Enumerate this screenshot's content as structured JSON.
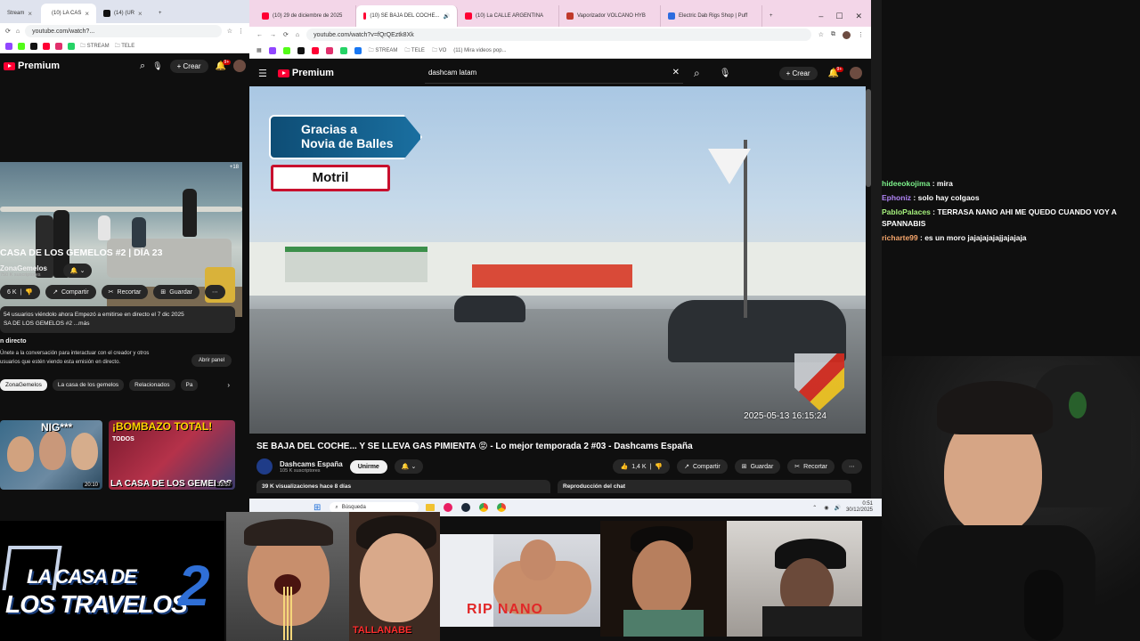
{
  "left_browser": {
    "tabs": [
      {
        "label": "Stream",
        "fav": "#9146ff"
      },
      {
        "label": "(10) LA CAS",
        "fav": "#ff0033"
      },
      {
        "label": "(14) (UR",
        "fav": "#111111"
      }
    ],
    "url": "youtube.com/watch?...",
    "bookmarks": [
      "STREAM",
      "TELE"
    ],
    "premium_label": "Premium",
    "crear_label": "Crear",
    "notif_count": "9+",
    "video_badge": "+18",
    "video_title": "CASA DE LOS GEMELOS #2 | DÍA 23",
    "channel_name": "ZonaGemelos",
    "subscribers": "750 K suscriptores",
    "actions": {
      "likes": "6 K",
      "share": "Compartir",
      "clip": "Recortar",
      "save": "Guardar"
    },
    "description_line1": "54 usuarios viéndolo ahora  Empezó a emitirse en directo el 7 dic 2025",
    "description_line2": "SA DE LOS GEMELOS #2 ...más",
    "live_chat_heading": "n directo",
    "live_chat_text1": "Únete a la conversación para interactuar con el creador y otros",
    "live_chat_text2": "usuarios que estén viendo esta emisión en directo.",
    "open_panel_label": "Abrir panel",
    "chips": [
      "ZonaGemelos",
      "La casa de los gemelos",
      "Relacionados",
      "Pa"
    ],
    "thumbs": [
      {
        "overlay": "NIG***",
        "duration": "20:10"
      },
      {
        "overlay": "¡BOMBAZO TOTAL!",
        "sub1": "TODOS",
        "sub2": "LA CASA DE LOS GEMELOS",
        "duration": "33:57"
      }
    ]
  },
  "right_browser": {
    "tabs": [
      {
        "label": "(10) 29 de diciembre de 2025",
        "fav": "#ff0033",
        "active": false
      },
      {
        "label": "(10) SE BAJA DEL COCHE...",
        "fav": "#ff0033",
        "active": true
      },
      {
        "label": "(10) La CALLE ARGENTINA",
        "fav": "#ff0033",
        "active": false
      },
      {
        "label": "Vaporizador VOLCANO HYB",
        "fav": "#c0392b",
        "active": false
      },
      {
        "label": "Electric Dab Rigs Shop | Puff",
        "fav": "#2d6cdf",
        "active": false
      }
    ],
    "url": "youtube.com/watch?v=fQrQEztk8Xk",
    "bookmarks": [
      "STREAM",
      "TELE",
      "VO",
      "(11) Mira videos pop..."
    ],
    "premium_label": "Premium",
    "search_query": "dashcam latam",
    "crear_label": "Crear",
    "notif_count": "9+",
    "video_overlay_banner_line1": "Gracias a",
    "video_overlay_banner_line2": "Novia de Balles",
    "video_overlay_place": "Motril",
    "video_timestamp": "2025-05-13 16:15:24",
    "video_title": "SE BAJA DEL COCHE... Y SE LLEVA GAS PIMIENTA 😡 - Lo mejor temporada 2 #03 - Dashcams España",
    "channel_name": "Dashcams España",
    "subscribers": "105 K suscriptores",
    "join_label": "Unirme",
    "likes": "1,4 K",
    "share_label": "Compartir",
    "save_label": "Guardar",
    "clip_label": "Recortar",
    "views": "39 K visualizaciones  hace 8 días",
    "chat_replay_label": "Reproducción del chat"
  },
  "taskbar": {
    "search_placeholder": "Búsqueda",
    "time": "0:51",
    "date": "30/12/2025"
  },
  "chat": [
    {
      "user": "hideeokojima",
      "color": "#7cf08a",
      "text": "mira"
    },
    {
      "user": "Ephoniz",
      "color": "#b084f5",
      "text": "solo hay colgaos"
    },
    {
      "user": "PabloPalaces",
      "color": "#a5f07c",
      "text": "TERRASA NANO AHI ME QUEDO CUANDO VOY A SPANNABIS"
    },
    {
      "user": "richarte99",
      "color": "#f5a56b",
      "text": "es un moro jajajajajajjajajaja"
    }
  ],
  "bottom": {
    "logo_line1": "LA CASA DE",
    "logo_line2": "LOS TRAVELOS",
    "logo_number": "2",
    "caption_tallanabe": "TALLANABE",
    "caption_rip": "RIP NANO"
  }
}
